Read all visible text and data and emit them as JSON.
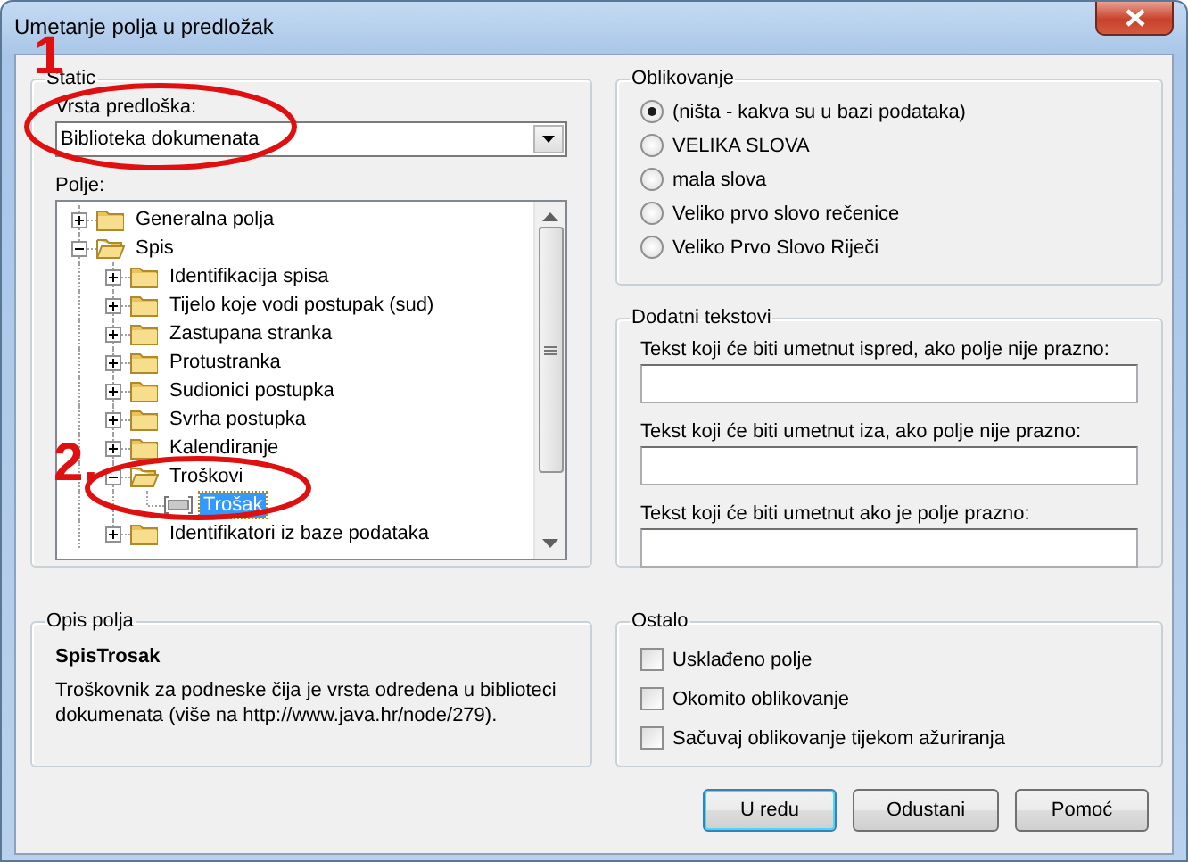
{
  "window": {
    "title": "Umetanje polja u predložak"
  },
  "annotations": [
    {
      "label": "1"
    },
    {
      "label": "2."
    }
  ],
  "template_group": {
    "legend": "Static",
    "type_label": "Vrsta predloška:",
    "type_value": "Biblioteka dokumenata",
    "field_label": "Polje:",
    "tree": [
      {
        "label": "Generalna polja",
        "kind": "folder",
        "expanded": false,
        "selected": false
      },
      {
        "label": "Spis",
        "kind": "folder",
        "expanded": true,
        "selected": false,
        "children": [
          {
            "label": "Identifikacija spisa",
            "kind": "folder",
            "expanded": false,
            "selected": false
          },
          {
            "label": "Tijelo koje vodi postupak (sud)",
            "kind": "folder",
            "expanded": false,
            "selected": false
          },
          {
            "label": "Zastupana stranka",
            "kind": "folder",
            "expanded": false,
            "selected": false
          },
          {
            "label": "Protustranka",
            "kind": "folder",
            "expanded": false,
            "selected": false
          },
          {
            "label": "Sudionici postupka",
            "kind": "folder",
            "expanded": false,
            "selected": false
          },
          {
            "label": "Svrha postupka",
            "kind": "folder",
            "expanded": false,
            "selected": false
          },
          {
            "label": "Kalendiranje",
            "kind": "folder",
            "expanded": false,
            "selected": false
          },
          {
            "label": "Troškovi",
            "kind": "folder",
            "expanded": true,
            "selected": false,
            "children": [
              {
                "label": "Trošak",
                "kind": "field",
                "selected": true
              }
            ]
          },
          {
            "label": "Identifikatori iz baze podataka",
            "kind": "folder",
            "expanded": false,
            "selected": false
          }
        ]
      }
    ]
  },
  "formatting": {
    "legend": "Oblikovanje",
    "options": [
      {
        "label": "(ništa - kakva su u bazi podataka)",
        "selected": true
      },
      {
        "label": "VELIKA SLOVA",
        "selected": false
      },
      {
        "label": "mala slova",
        "selected": false
      },
      {
        "label": "Veliko prvo slovo rečenice",
        "selected": false
      },
      {
        "label": "Veliko Prvo Slovo Riječi",
        "selected": false
      }
    ]
  },
  "extra_texts": {
    "legend": "Dodatni tekstovi",
    "fields": [
      {
        "label": "Tekst koji će biti umetnut ispred, ako polje nije prazno:"
      },
      {
        "label": "Tekst koji će biti umetnut iza, ako polje nije prazno:"
      },
      {
        "label": "Tekst koji će biti umetnut ako je polje prazno:"
      }
    ]
  },
  "field_description": {
    "legend": "Opis polja",
    "name": "SpisTrosak",
    "text": "Troškovnik za podneske čija je vrsta određena u biblioteci dokumenata (više na http://www.java.hr/node/279)."
  },
  "other": {
    "legend": "Ostalo",
    "options": [
      {
        "label": "Usklađeno polje",
        "checked": false
      },
      {
        "label": "Okomito oblikovanje",
        "checked": false
      },
      {
        "label": "Sačuvaj oblikovanje tijekom ažuriranja",
        "checked": false
      }
    ]
  },
  "buttons": [
    {
      "label": "U redu",
      "default": true
    },
    {
      "label": "Odustani",
      "default": false
    },
    {
      "label": "Pomoć",
      "default": false
    }
  ]
}
